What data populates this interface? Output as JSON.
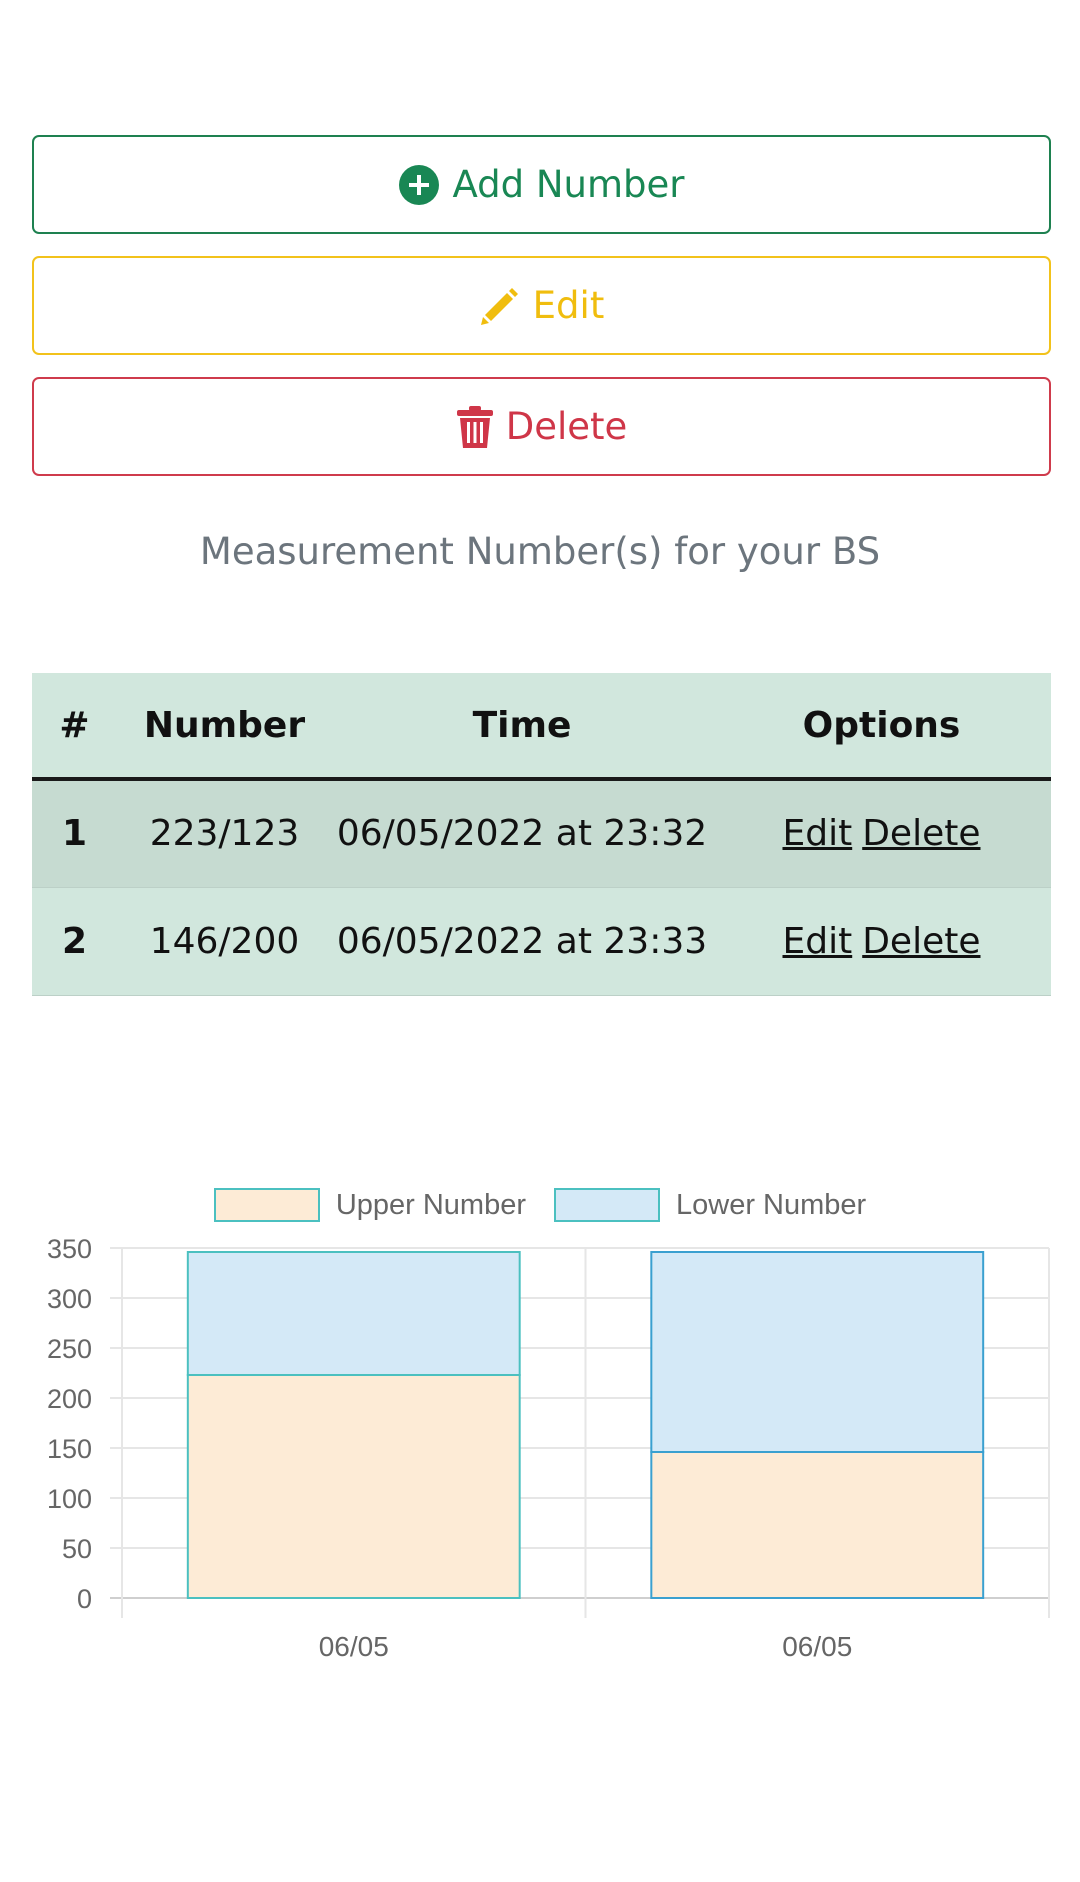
{
  "buttons": {
    "add_label": "Add Number",
    "edit_label": "Edit",
    "delete_label": "Delete",
    "add_icon": "plus-circle-icon",
    "edit_icon": "pencil-icon",
    "delete_icon": "trash-icon"
  },
  "caption": "Measurement Number(s) for your BS",
  "table": {
    "headers": [
      "#",
      "Number",
      "Time",
      "Options"
    ],
    "rows": [
      {
        "index": "1",
        "number": "223/123",
        "time": "06/05/2022 at 23:32",
        "edit": "Edit",
        "delete": "Delete"
      },
      {
        "index": "2",
        "number": "146/200",
        "time": "06/05/2022 at 23:33",
        "edit": "Edit",
        "delete": "Delete"
      }
    ]
  },
  "chart_data": {
    "type": "bar",
    "stacked": true,
    "categories": [
      "06/05",
      "06/05"
    ],
    "series": [
      {
        "name": "Upper Number",
        "values": [
          223,
          146
        ],
        "color": "#fdebd6",
        "border": "#4bc0c0"
      },
      {
        "name": "Lower Number",
        "values": [
          123,
          200
        ],
        "color": "#d4e9f7",
        "border": "#4bc0c0"
      }
    ],
    "ylim": [
      0,
      350
    ],
    "yticks": [
      0,
      50,
      100,
      150,
      200,
      250,
      300,
      350
    ],
    "grid": true,
    "legend_position": "top"
  }
}
